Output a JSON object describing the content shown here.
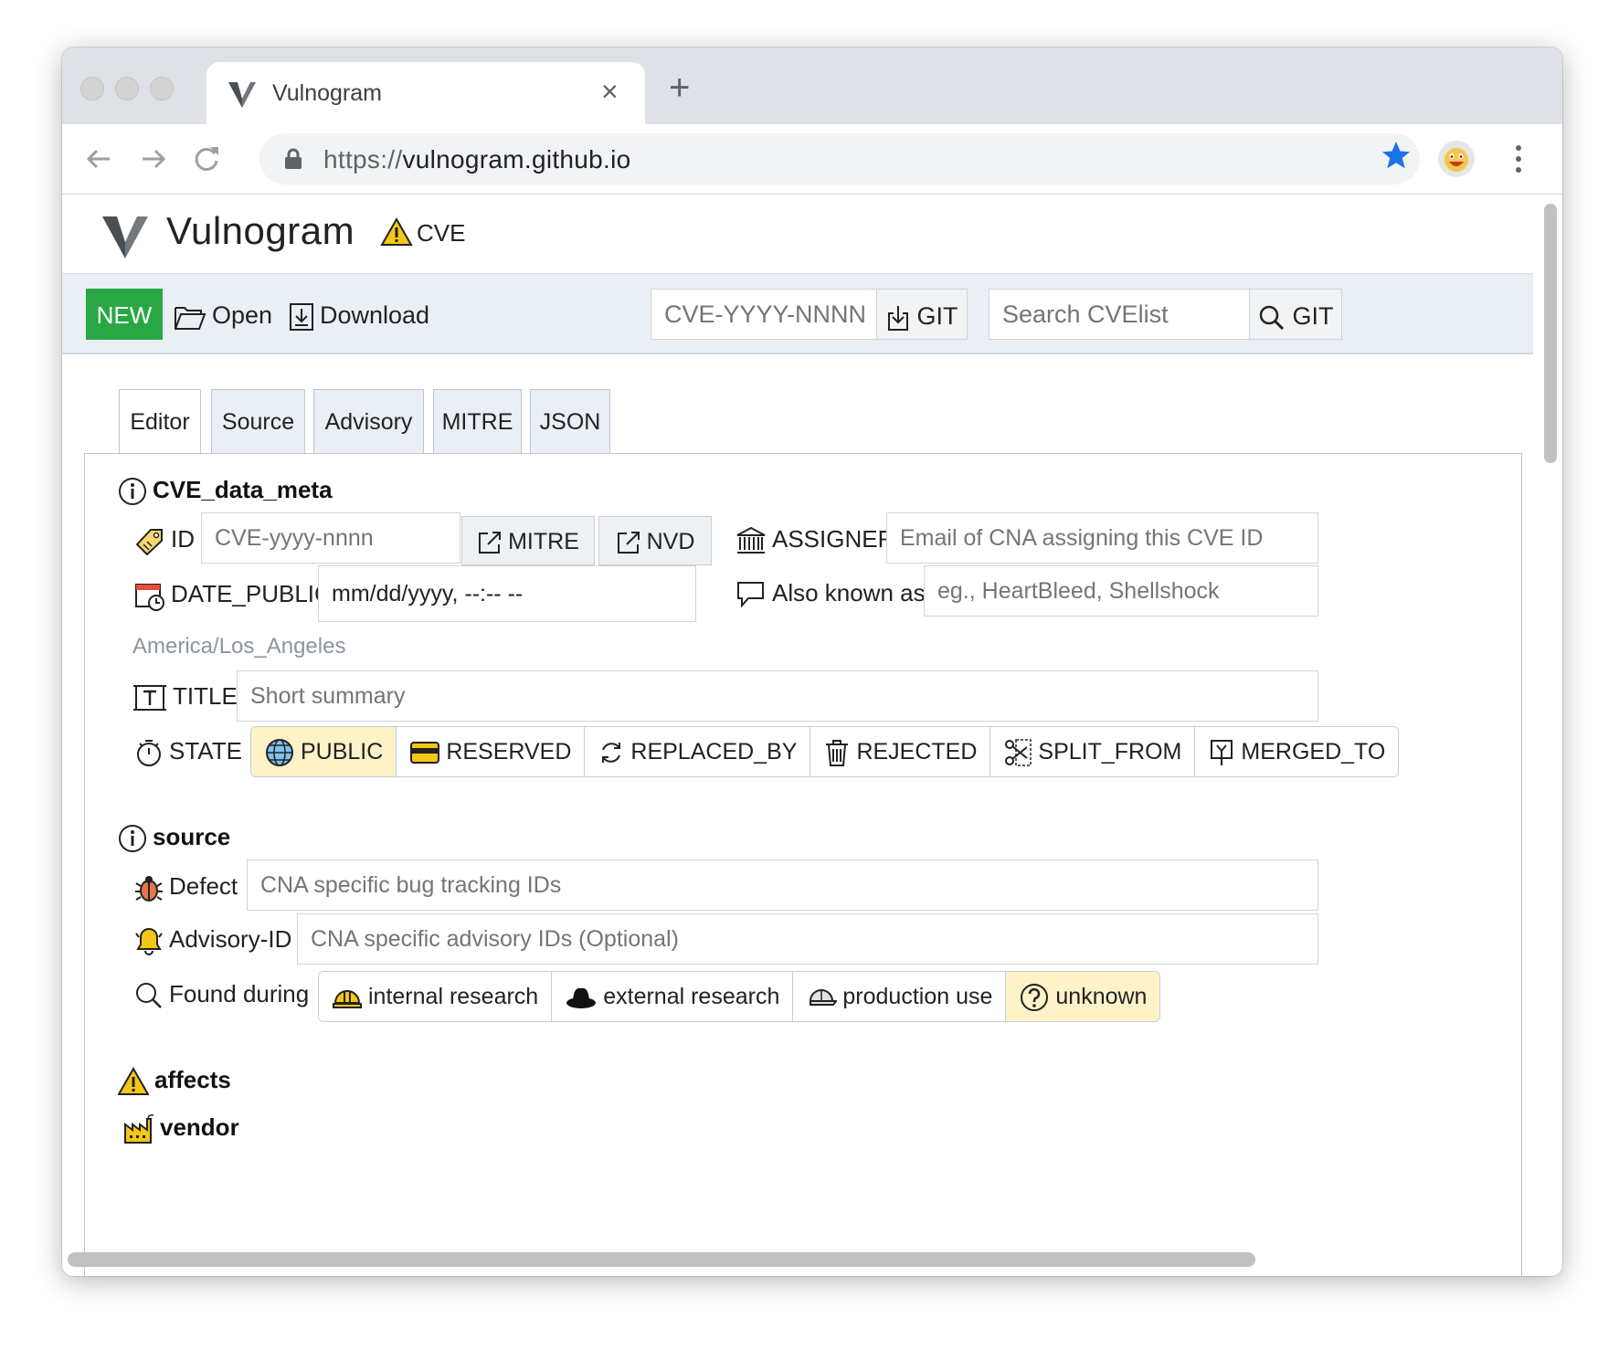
{
  "browser": {
    "tab_title": "Vulnogram",
    "tab_close": "×",
    "new_tab": "+",
    "url_scheme": "https://",
    "url_host": "vulnogram.github.io"
  },
  "app": {
    "title": "Vulnogram",
    "badge": "CVE"
  },
  "actions": {
    "new_label": "NEW",
    "open_label": "Open",
    "download_label": "Download",
    "cve_id_placeholder": "CVE-YYYY-NNNN",
    "git_label_1": "GIT",
    "search_placeholder": "Search CVElist",
    "git_label_2": "GIT"
  },
  "tabs": [
    {
      "label": "Editor"
    },
    {
      "label": "Source"
    },
    {
      "label": "Advisory"
    },
    {
      "label": "MITRE"
    },
    {
      "label": "JSON"
    }
  ],
  "cve_data_meta": {
    "heading": "CVE_data_meta",
    "id_label": "ID",
    "id_placeholder": "CVE-yyyy-nnnn",
    "mitre_label": "MITRE",
    "nvd_label": "NVD",
    "assigner_label": "ASSIGNER",
    "assigner_placeholder": "Email of CNA assigning this CVE ID",
    "date_label": "DATE_PUBLIC",
    "date_value": "mm/dd/yyyy, --:-- --",
    "aka_label": "Also known as",
    "aka_placeholder": "eg., HeartBleed, Shellshock",
    "timezone": "America/Los_Angeles",
    "title_label": "TITLE",
    "title_placeholder": "Short summary",
    "state_label": "STATE",
    "state_options": [
      "PUBLIC",
      "RESERVED",
      "REPLACED_BY",
      "REJECTED",
      "SPLIT_FROM",
      "MERGED_TO"
    ],
    "state_selected": "PUBLIC"
  },
  "source": {
    "heading": "source",
    "defect_label": "Defect",
    "defect_placeholder": "CNA specific bug tracking IDs",
    "advisory_label": "Advisory-ID",
    "advisory_placeholder": "CNA specific advisory IDs (Optional)",
    "found_label": "Found during",
    "found_options": [
      "internal research",
      "external research",
      "production use",
      "unknown"
    ],
    "found_selected": "unknown"
  },
  "affects": {
    "heading": "affects",
    "vendor_label": "vendor"
  },
  "colors": {
    "new_button": "#2aa745",
    "selected_option": "#fdf2c8",
    "action_bar": "#e9eff5",
    "star": "#1a73e8"
  }
}
